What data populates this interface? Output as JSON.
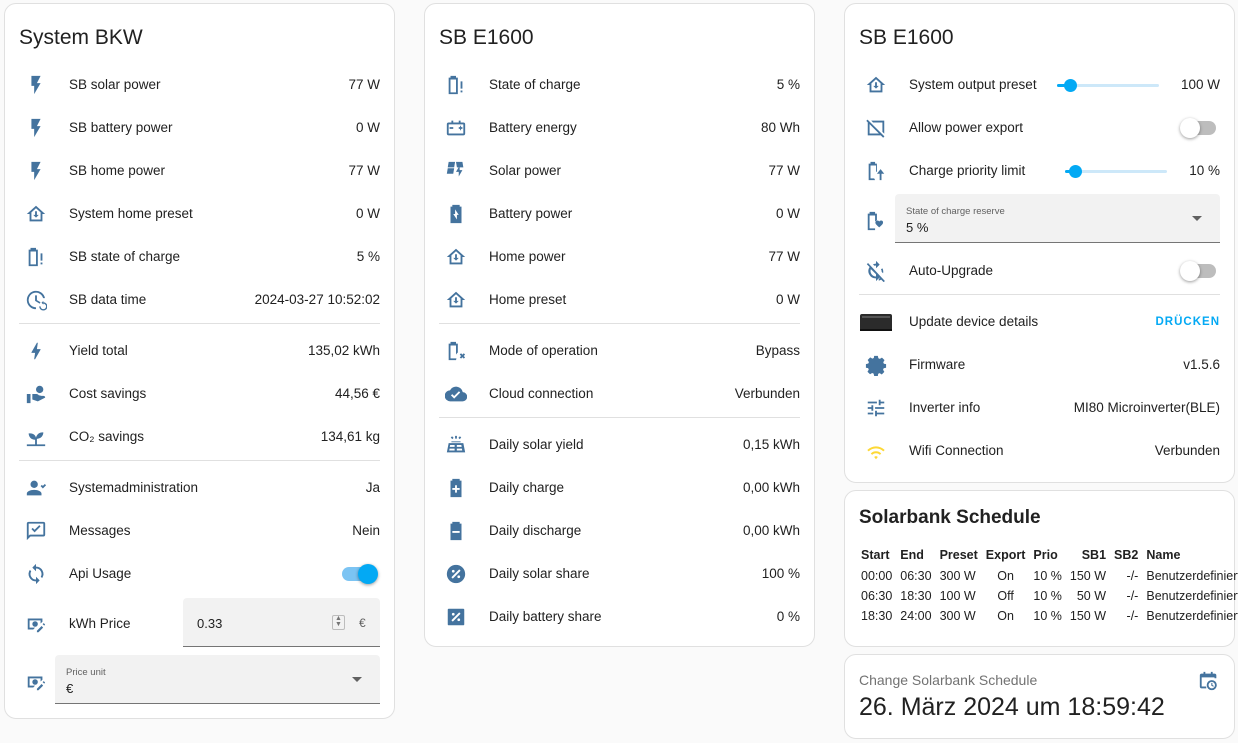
{
  "colors": {
    "icon": "#44739e",
    "accent": "#03a9f4",
    "wifi": "#fdd835",
    "divider": "#e0e0e0"
  },
  "system_bkw": {
    "title": "System BKW",
    "rows": [
      {
        "label": "SB solar power",
        "value": "77 W",
        "icon": "flash-icon"
      },
      {
        "label": "SB battery power",
        "value": "0 W",
        "icon": "flash-icon"
      },
      {
        "label": "SB home power",
        "value": "77 W",
        "icon": "flash-icon"
      },
      {
        "label": "System home preset",
        "value": "0 W",
        "icon": "home-import-icon"
      },
      {
        "label": "SB state of charge",
        "value": "5 %",
        "icon": "battery-alert-icon"
      },
      {
        "label": "SB data time",
        "value": "2024-03-27 10:52:02",
        "icon": "clock-cycle-icon"
      },
      {
        "label": "Yield total",
        "value": "135,02 kWh",
        "icon": "lightning-bolt-icon"
      },
      {
        "label": "Cost savings",
        "value": "44,56 €",
        "icon": "hand-coin-icon"
      },
      {
        "label": "CO₂ savings",
        "value": "134,61 kg",
        "icon": "sprout-icon"
      },
      {
        "label": "Systemadministration",
        "value": "Ja",
        "icon": "account-check-icon"
      },
      {
        "label": "Messages",
        "value": "Nein",
        "icon": "message-check-icon"
      },
      {
        "label": "Api Usage",
        "value": "",
        "icon": "sync-icon",
        "toggle_on": true
      },
      {
        "label": "kWh Price",
        "value": "0.33",
        "icon": "cash-edit-icon",
        "unit": "€"
      }
    ],
    "price_unit": {
      "label": "Price unit",
      "value": "€"
    }
  },
  "sb_e1600_a": {
    "title": "SB E1600",
    "rows": [
      {
        "label": "State of charge",
        "value": "5 %",
        "icon": "battery-alert-icon"
      },
      {
        "label": "Battery energy",
        "value": "80 Wh",
        "icon": "car-battery-icon"
      },
      {
        "label": "Solar power",
        "value": "77 W",
        "icon": "solar-power-icon"
      },
      {
        "label": "Battery power",
        "value": "0 W",
        "icon": "battery-charging-icon"
      },
      {
        "label": "Home power",
        "value": "77 W",
        "icon": "home-lightning-icon"
      },
      {
        "label": "Home preset",
        "value": "0 W",
        "icon": "home-import-icon"
      },
      {
        "label": "Mode of operation",
        "value": "Bypass",
        "icon": "battery-remove-icon"
      },
      {
        "label": "Cloud connection",
        "value": "Verbunden",
        "icon": "cloud-check-icon"
      },
      {
        "label": "Daily solar yield",
        "value": "0,15 kWh",
        "icon": "solar-panel-icon"
      },
      {
        "label": "Daily charge",
        "value": "0,00 kWh",
        "icon": "battery-plus-icon"
      },
      {
        "label": "Daily discharge",
        "value": "0,00 kWh",
        "icon": "battery-minus-icon"
      },
      {
        "label": "Daily solar share",
        "value": "100 %",
        "icon": "percent-circle-icon"
      },
      {
        "label": "Daily battery share",
        "value": "0 %",
        "icon": "percent-box-icon"
      }
    ]
  },
  "sb_e1600_b": {
    "title": "SB E1600",
    "system_output_preset": {
      "label": "System output preset",
      "value": "100 W",
      "level_percent": 13
    },
    "allow_power_export": {
      "label": "Allow power export",
      "on": false
    },
    "charge_priority_limit": {
      "label": "Charge priority limit",
      "value": "10 %",
      "level_percent": 10
    },
    "soc_reserve": {
      "label": "State of charge reserve",
      "value": "5 %"
    },
    "auto_upgrade": {
      "label": "Auto-Upgrade",
      "on": false
    },
    "update_device": {
      "label": "Update device details",
      "action": "DRÜCKEN"
    },
    "firmware": {
      "label": "Firmware",
      "value": "v1.5.6"
    },
    "inverter_info": {
      "label": "Inverter info",
      "value": "MI80 Microinverter(BLE)"
    },
    "wifi": {
      "label": "Wifi Connection",
      "value": "Verbunden"
    }
  },
  "schedule": {
    "title": "Solarbank Schedule",
    "headers": [
      "Start",
      "End",
      "Preset",
      "Export",
      "Prio",
      "SB1",
      "SB2",
      "Name"
    ],
    "rows": [
      [
        "00:00",
        "06:30",
        "300 W",
        "On",
        "10 %",
        "150 W",
        "-/-",
        "Benutzerdefiniert"
      ],
      [
        "06:30",
        "18:30",
        "100 W",
        "Off",
        "10 %",
        "50 W",
        "-/-",
        "Benutzerdefiniert"
      ],
      [
        "18:30",
        "24:00",
        "300 W",
        "On",
        "10 %",
        "150 W",
        "-/-",
        "Benutzerdefiniert"
      ]
    ]
  },
  "change_schedule": {
    "label": "Change Solarbank Schedule",
    "value": "26. März 2024 um 18:59:42"
  }
}
